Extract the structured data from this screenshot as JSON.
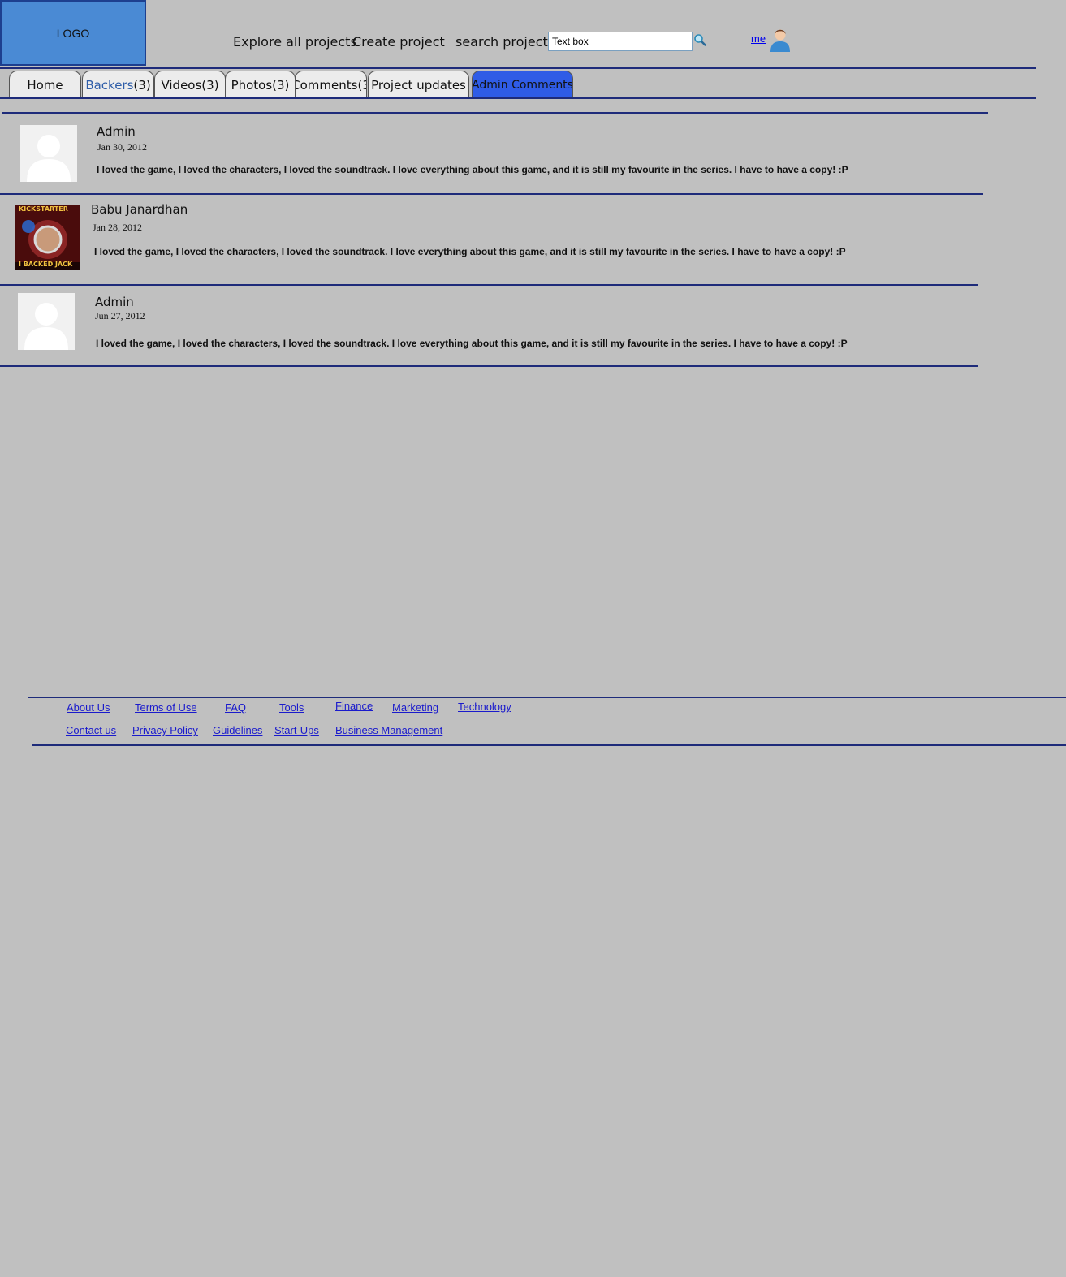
{
  "header": {
    "logo": "LOGO",
    "nav": {
      "explore": "Explore all projects",
      "create": "Create project",
      "search_label": "search project"
    },
    "search_value": "Text box",
    "user_link": "me"
  },
  "tabs": [
    {
      "label_prefix": "Backers",
      "label_suffix": "(3)"
    },
    {
      "label": "Home"
    },
    {
      "label": "Videos(3)"
    },
    {
      "label": "Photos(3)"
    },
    {
      "label": "Comments(3"
    },
    {
      "label": "Project updates"
    },
    {
      "label": "Admin Comments"
    }
  ],
  "comments": [
    {
      "author": "Admin",
      "date": "Jan 30, 2012",
      "text": "I loved the game, I loved the characters, I loved the soundtrack. I love everything about this game, and it is still my favourite in the series. I have to have a copy! :P"
    },
    {
      "author": "Babu Janardhan",
      "date": "Jan 28, 2012",
      "text": "I loved the game, I loved the characters, I loved the soundtrack. I love everything about this game, and it is still my favourite in the series. I have to have a copy! :P",
      "avatar_text_top": "KICKSTARTER",
      "avatar_text_bottom": "I BACKED JACK"
    },
    {
      "author": "Admin",
      "date": "Jun 27, 2012",
      "text": "I loved the game, I loved the characters, I loved the soundtrack. I love everything about this game, and it is still my favourite in the series. I have to have a copy! :P"
    }
  ],
  "footer": {
    "row1": [
      "About Us",
      "Terms of Use",
      "FAQ",
      "Tools",
      "Finance",
      "Marketing",
      "Technology"
    ],
    "row2": [
      "Contact us",
      "Privacy Policy",
      "Guidelines",
      "Start-Ups",
      "Business Management"
    ]
  },
  "colors": {
    "background": "#c0c0c0",
    "logo": "#4a8ad4",
    "rule": "#1e2b7a",
    "active_tab": "#2f5ce6",
    "link": "#1a1acc"
  }
}
